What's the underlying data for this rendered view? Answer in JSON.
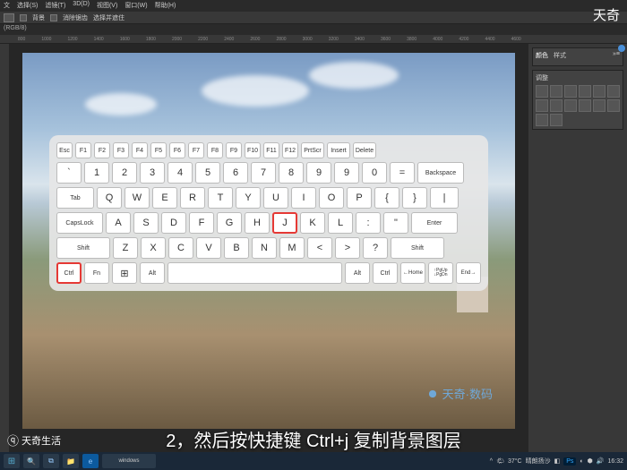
{
  "menu": {
    "items": [
      "文",
      "选择(S)",
      "滤镜(T)",
      "3D(D)",
      "视图(V)",
      "窗口(W)",
      "帮助(H)"
    ]
  },
  "options": {
    "chk": "背景",
    "sp": "消除锯齿",
    "sel": "选择并遮住"
  },
  "tab": {
    "label": "(RGB/8)"
  },
  "ruler": {
    "marks": [
      "800",
      "1000",
      "1200",
      "1400",
      "1600",
      "1800",
      "2000",
      "2200",
      "2400",
      "2600",
      "2800",
      "3000",
      "3200",
      "3400",
      "3600",
      "3800",
      "4000",
      "4200",
      "4400",
      "4600"
    ]
  },
  "keys": {
    "r1": [
      "Esc",
      "F1",
      "F2",
      "F3",
      "F4",
      "F5",
      "F6",
      "F7",
      "F8",
      "F9",
      "F10",
      "F11",
      "F12",
      "PrtScr",
      "Insert",
      "Delete"
    ],
    "r2": [
      "~",
      "!",
      "@",
      "#",
      "$",
      "%",
      "^",
      "&",
      "*",
      "(",
      "(",
      ")",
      "+",
      "Backspace"
    ],
    "r2b": [
      "`",
      "1",
      "2",
      "3",
      "4",
      "5",
      "6",
      "7",
      "8",
      "9",
      "9",
      "0",
      "=",
      ""
    ],
    "r3": [
      "Tab",
      "Q",
      "W",
      "E",
      "R",
      "T",
      "Y",
      "U",
      "I",
      "O",
      "P",
      "{",
      "}",
      "|"
    ],
    "r4": [
      "CapsLock",
      "A",
      "S",
      "D",
      "F",
      "G",
      "H",
      "J",
      "K",
      "L",
      ":",
      "\"",
      "Enter"
    ],
    "r5": [
      "Shift",
      "Z",
      "X",
      "C",
      "V",
      "B",
      "N",
      "M",
      "<",
      ">",
      "?",
      "Shift"
    ],
    "r6": [
      "Ctrl",
      "Fn",
      "",
      "Alt",
      "",
      "Alt",
      "Ctrl",
      "Home",
      "PgUp",
      "End"
    ]
  },
  "panels": {
    "p1": {
      "tabs": [
        "颜色",
        "样式"
      ]
    },
    "p2": {
      "title": "调整"
    }
  },
  "watermark": {
    "text": "天奇·数码"
  },
  "caption": {
    "num": "2，",
    "text": "然后按快捷键 Ctrl+j 复制背景图层"
  },
  "brand": {
    "tr": "天奇",
    "bl": "天奇生活"
  },
  "taskbar": {
    "temp": "37°C",
    "weather": "晴朗扬沙",
    "time": "16:32"
  }
}
